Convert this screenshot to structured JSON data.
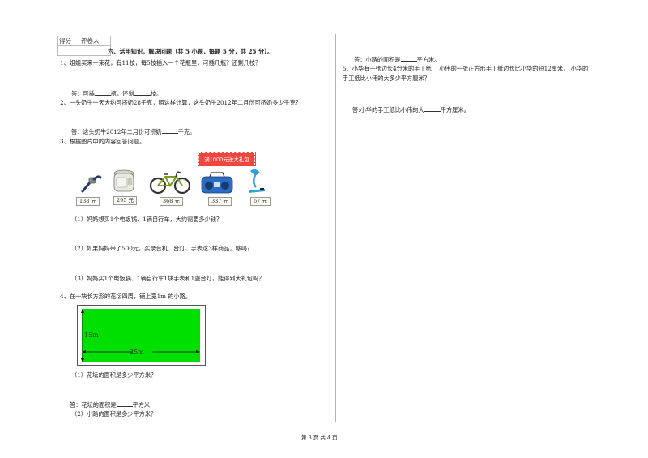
{
  "score_box": {
    "col1": "得分",
    "col2": "评卷人"
  },
  "section_title": "六、活用知识，解决问题（共 5 小题，每题 5 分，共 25 分）。",
  "q1": {
    "text": "1、姐姐买来一束花，有11枝，每5枝插入一个花瓶里，可插几瓶？还剩几枝？",
    "answer_prefix": "答：可插",
    "answer_mid": "瓶，还剩",
    "answer_suffix": "枝。"
  },
  "q2": {
    "text": "2、一头奶牛一天大约可挤奶28千克，照这样计算，这头奶牛2012年二月份可挤奶多少千克？",
    "answer_prefix": "答：这头奶牛2012年二月份可挤奶",
    "answer_suffix": "千克。"
  },
  "q3": {
    "text": "3、根据图片中的内容回答问题。",
    "banner": "满1000元送大礼包",
    "products": [
      {
        "name": "watch",
        "price": "138 元"
      },
      {
        "name": "rice-cooker",
        "price": "295 元"
      },
      {
        "name": "bicycle",
        "price": "368 元"
      },
      {
        "name": "radio",
        "price": "337 元"
      },
      {
        "name": "desk-lamp",
        "price": "67 元"
      }
    ],
    "sub1": "（1）妈妈想买1个电饭锅、1辆自行车，大约需要多少钱？",
    "sub2": "（2）如果妈妈带了500元，买录音机、台灯、手表这3样商品，够吗？",
    "sub3": "（3）妈妈买1个电饭锅、1辆自行车1块手表和1盏台灯，能得到大礼包吗？"
  },
  "q4": {
    "text": "4、在一块长方形的花坛四周，铺上宽1m 的小路。",
    "height_label": "15m",
    "width_label": "25m",
    "sub1": "（1）花坛的面积是多少平方米？",
    "answer1_prefix": "答：花坛的面积是",
    "answer1_suffix": "平方米",
    "sub2": "（2）小路的面积是多少平方米？",
    "answer2_prefix": "答：小路的面积是",
    "answer2_suffix": "平方米。"
  },
  "q5": {
    "line1": "5、小华有一张边长4分米的手工纸， 小伟的一张正方形手工纸边长比小华的短12厘米， 小华的",
    "line2": "手工纸比小伟的大多少平方厘米？",
    "answer_prefix": "答:小华的手工纸比小伟的大",
    "answer_suffix": "平方厘米。"
  },
  "footer": "第 3 页 共 4 页",
  "colors": {
    "flowerbed": "#00e000",
    "banner": "#f2453d"
  }
}
